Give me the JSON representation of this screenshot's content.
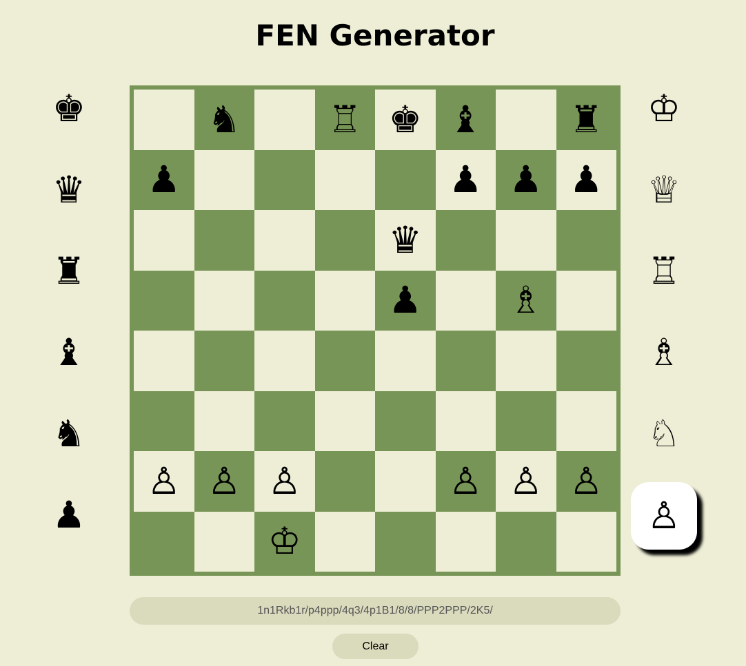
{
  "title": "FEN Generator",
  "board": {
    "rows": [
      [
        "",
        "♞",
        "",
        "♖",
        "♚",
        "♝",
        "",
        "♜"
      ],
      [
        "♟",
        "",
        "",
        "",
        "",
        "♟",
        "♟",
        "♟"
      ],
      [
        "",
        "",
        "",
        "",
        "♛",
        "",
        "",
        ""
      ],
      [
        "",
        "",
        "",
        "",
        "♟",
        "",
        "♗",
        ""
      ],
      [
        "",
        "",
        "",
        "",
        "",
        "",
        "",
        ""
      ],
      [
        "",
        "",
        "",
        "",
        "",
        "",
        "",
        ""
      ],
      [
        "♙",
        "♙",
        "♙",
        "",
        "",
        "♙",
        "♙",
        "♙"
      ],
      [
        "",
        "",
        "♔",
        "",
        "",
        "",
        "",
        ""
      ]
    ],
    "light_color": "#eeedd5",
    "dark_color": "#779556"
  },
  "palette": {
    "black": [
      {
        "glyph": "♚",
        "icon": "black-king-icon"
      },
      {
        "glyph": "♛",
        "icon": "black-queen-icon"
      },
      {
        "glyph": "♜",
        "icon": "black-rook-icon"
      },
      {
        "glyph": "♝",
        "icon": "black-bishop-icon"
      },
      {
        "glyph": "♞",
        "icon": "black-knight-icon"
      },
      {
        "glyph": "♟",
        "icon": "black-pawn-icon"
      }
    ],
    "white": [
      {
        "glyph": "♔",
        "icon": "white-king-icon"
      },
      {
        "glyph": "♕",
        "icon": "white-queen-icon"
      },
      {
        "glyph": "♖",
        "icon": "white-rook-icon"
      },
      {
        "glyph": "♗",
        "icon": "white-bishop-icon"
      },
      {
        "glyph": "♘",
        "icon": "white-knight-icon"
      },
      {
        "glyph": "♙",
        "icon": "white-pawn-icon"
      }
    ],
    "selected": "white-pawn-icon"
  },
  "fen": {
    "value": "1n1Rkb1r/p4ppp/4q3/4p1B1/8/8/PPP2PPP/2K5/"
  },
  "clear_label": "Clear"
}
